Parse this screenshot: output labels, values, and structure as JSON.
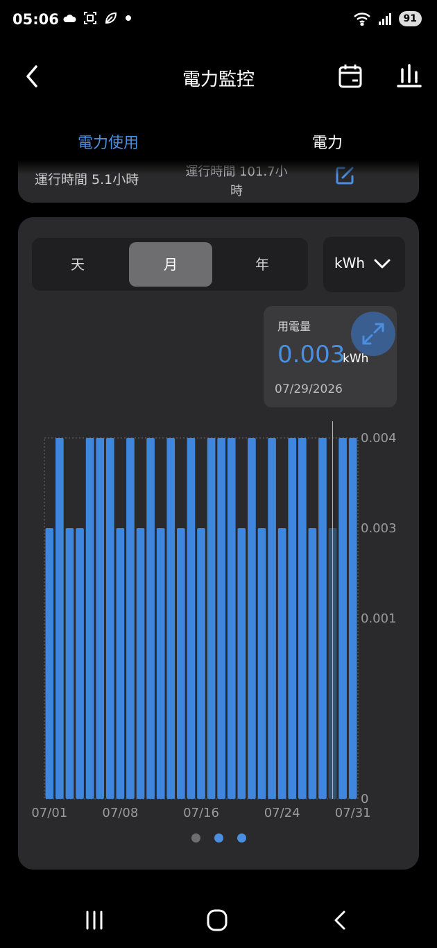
{
  "status_bar": {
    "time": "05:06",
    "battery": "91",
    "icons": [
      "cloud-icon",
      "screenshot-icon",
      "leaf-icon",
      "dot-icon",
      "wifi-icon",
      "signal-icon"
    ]
  },
  "header": {
    "title": "電力監控",
    "back_icon": "back-arrow-icon",
    "calendar_icon": "calendar-icon",
    "stats_icon": "bar-chart-icon"
  },
  "tabs": [
    {
      "label": "電力使用",
      "active": true
    },
    {
      "label": "電力",
      "active": false
    }
  ],
  "runtime": {
    "text": "運行時間 5.1小時",
    "text2_line1": "運行時間 101.7小",
    "text2_line2": "時",
    "edit_icon": "edit-icon"
  },
  "period": {
    "options": [
      "天",
      "月",
      "年"
    ],
    "selected": "月"
  },
  "unit_select": {
    "value": "kWh"
  },
  "tooltip": {
    "label": "用電量",
    "value": "0.003",
    "unit": "kWh",
    "date": "07/29/2026"
  },
  "colors": {
    "accent": "#4a8fe0",
    "bar": "#3f86df",
    "bar_selected": "#35516e",
    "card": "#2a2a2c"
  },
  "chart_data": {
    "type": "bar",
    "title": "",
    "xlabel": "",
    "ylabel": "",
    "categories": [
      "07/01",
      "07/02",
      "07/03",
      "07/04",
      "07/05",
      "07/06",
      "07/07",
      "07/08",
      "07/09",
      "07/10",
      "07/11",
      "07/12",
      "07/13",
      "07/14",
      "07/15",
      "07/16",
      "07/17",
      "07/18",
      "07/19",
      "07/20",
      "07/21",
      "07/22",
      "07/23",
      "07/24",
      "07/25",
      "07/26",
      "07/27",
      "07/28",
      "07/29",
      "07/30",
      "07/31"
    ],
    "values": [
      0.003,
      0.004,
      0.003,
      0.003,
      0.004,
      0.004,
      0.004,
      0.003,
      0.004,
      0.003,
      0.004,
      0.003,
      0.004,
      0.003,
      0.004,
      0.003,
      0.004,
      0.004,
      0.004,
      0.003,
      0.004,
      0.003,
      0.004,
      0.003,
      0.004,
      0.004,
      0.003,
      0.004,
      0.003,
      0.004,
      0.004
    ],
    "selected_index": 28,
    "x_tick_labels": [
      "07/01",
      "07/08",
      "07/16",
      "07/24",
      "07/31"
    ],
    "y_tick_labels": [
      "0.004",
      "0.003",
      "0.001",
      "0"
    ],
    "ylim": [
      0,
      0.004
    ],
    "grid": false,
    "legend": "none"
  },
  "pager": {
    "count": 3,
    "active_index": 0
  },
  "nav_bar": {
    "buttons": [
      "recent-apps-icon",
      "home-icon",
      "back-icon"
    ]
  }
}
